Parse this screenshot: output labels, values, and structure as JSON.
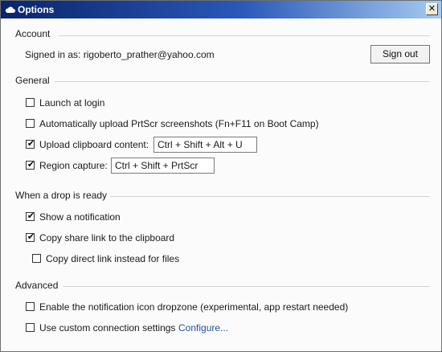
{
  "window": {
    "title": "Options",
    "close_glyph": "✕"
  },
  "account": {
    "heading": "Account",
    "signed_in_text": "Signed in as: rigoberto_prather@yahoo.com",
    "sign_out_label": "Sign out"
  },
  "general": {
    "heading": "General",
    "launch_at_login": {
      "label": "Launch at login",
      "checked": false
    },
    "auto_upload_prtscr": {
      "label": "Automatically upload PrtScr screenshots (Fn+F11 on Boot Camp)",
      "checked": false
    },
    "upload_clipboard": {
      "label": "Upload clipboard content:",
      "checked": true,
      "shortcut": "Ctrl + Shift + Alt + U"
    },
    "region_capture": {
      "label": "Region capture:",
      "checked": true,
      "shortcut": "Ctrl + Shift + PrtScr"
    }
  },
  "drop_ready": {
    "heading": "When a drop is ready",
    "show_notification": {
      "label": "Show a notification",
      "checked": true
    },
    "copy_share_link": {
      "label": "Copy share link to the clipboard",
      "checked": true
    },
    "copy_direct_link": {
      "label": "Copy direct link instead for files",
      "checked": false
    }
  },
  "advanced": {
    "heading": "Advanced",
    "notification_dropzone": {
      "label": "Enable the notification icon dropzone (experimental, app restart needed)",
      "checked": false
    },
    "custom_connection": {
      "label": "Use custom connection settings",
      "checked": false,
      "configure_link": "Configure..."
    }
  },
  "icons": {
    "app": "cloud-icon",
    "check": "checkmark-icon",
    "close": "close-icon"
  }
}
